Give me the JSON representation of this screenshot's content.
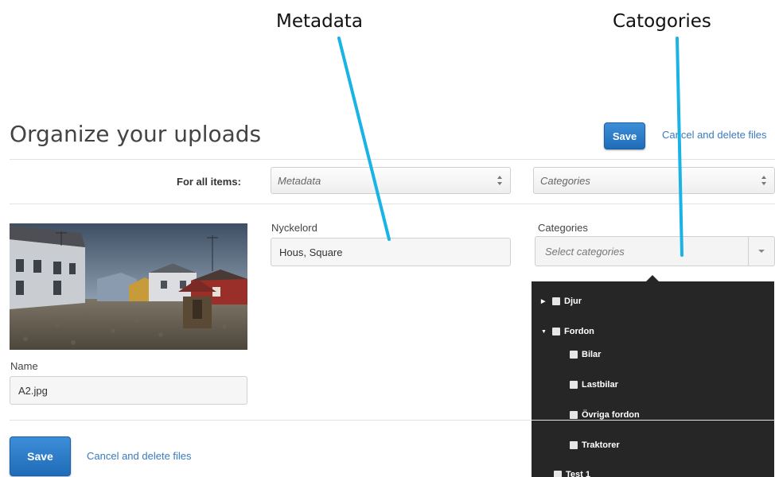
{
  "annotations": {
    "metadata": "Metadata",
    "categories": "Catogories"
  },
  "header": {
    "title": "Organize your uploads",
    "save_label": "Save",
    "cancel_label": "Cancel and delete files"
  },
  "bulk": {
    "label": "For all items:",
    "metadata_placeholder": "Metadata",
    "categories_placeholder": "Categories"
  },
  "item": {
    "name_label": "Name",
    "name_value": "A2.jpg",
    "keywords_label": "Nyckelord",
    "keywords_value": "Hous, Square",
    "categories_label": "Categories",
    "categories_placeholder": "Select categories"
  },
  "category_tree": [
    {
      "label": "Djur",
      "expanded": false
    },
    {
      "label": "Fordon",
      "expanded": true
    },
    {
      "label": "Bilar"
    },
    {
      "label": "Lastbilar"
    },
    {
      "label": "Övriga fordon"
    },
    {
      "label": "Traktorer"
    },
    {
      "label": "Test 1"
    }
  ],
  "footer": {
    "save_label": "Save",
    "cancel_label": "Cancel and delete files"
  },
  "colors": {
    "accent": "#2a7bc8",
    "link": "#3a7bbf",
    "dropdown_bg": "#262626",
    "pointer_line": "#1ab3e6"
  }
}
